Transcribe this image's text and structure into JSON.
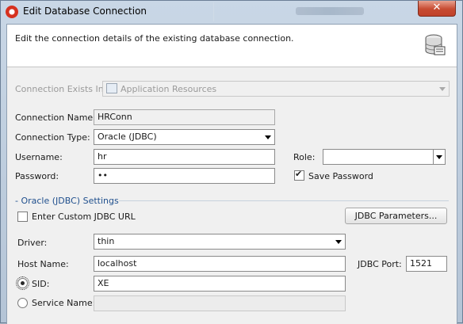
{
  "window": {
    "title": "Edit Database Connection",
    "close_label": "✕"
  },
  "header": {
    "description": "Edit the connection details of the existing database connection."
  },
  "connection_exists_in": {
    "label": "Connection Exists In:",
    "value": "Application Resources"
  },
  "form": {
    "connection_name": {
      "label": "Connection Name:",
      "value": "HRConn"
    },
    "connection_type": {
      "label": "Connection Type:",
      "value": "Oracle (JDBC)"
    },
    "username": {
      "label": "Username:",
      "value": "hr"
    },
    "password": {
      "label": "Password:",
      "value": "••"
    },
    "role": {
      "label": "Role:",
      "value": ""
    },
    "save_password": {
      "label": "Save Password",
      "checked": true
    }
  },
  "oracle_settings": {
    "section_title": "- Oracle (JDBC) Settings",
    "custom_url": {
      "label": "Enter Custom JDBC URL",
      "checked": false
    },
    "jdbc_parameters_button": "JDBC Parameters...",
    "driver": {
      "label": "Driver:",
      "value": "thin"
    },
    "host_name": {
      "label": "Host Name:",
      "value": "localhost"
    },
    "jdbc_port": {
      "label": "JDBC Port:",
      "value": "1521"
    },
    "sid": {
      "label": "SID:",
      "value": "XE",
      "selected": true
    },
    "service_name": {
      "label": "Service Name:",
      "value": "",
      "selected": false
    }
  },
  "colors": {
    "section_title": "#1f4f8d",
    "close_button": "#c74b31"
  }
}
